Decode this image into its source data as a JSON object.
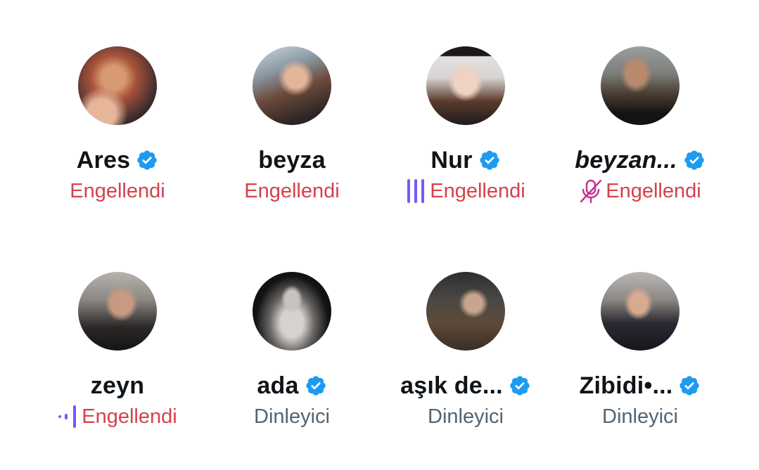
{
  "colors": {
    "blocked": "#d4424b",
    "listener": "#536471",
    "verified": "#1d9bf0",
    "speaking_indicator": "#7856ff",
    "muted_mic": "#c3328f"
  },
  "participants": [
    {
      "name": "Ares",
      "verified": true,
      "status": "Engellendi",
      "status_kind": "blocked",
      "indicator": "none"
    },
    {
      "name": "beyza",
      "verified": false,
      "status": "Engellendi",
      "status_kind": "blocked",
      "indicator": "none"
    },
    {
      "name": "Nur",
      "verified": true,
      "status": "Engellendi",
      "status_kind": "blocked",
      "indicator": "speaking-bars-icon"
    },
    {
      "name": "beyzan...",
      "verified": true,
      "status": "Engellendi",
      "status_kind": "blocked",
      "indicator": "muted-mic-icon"
    },
    {
      "name": "zeyn",
      "verified": false,
      "status": "Engellendi",
      "status_kind": "blocked",
      "indicator": "audio-level-icon"
    },
    {
      "name": "ada",
      "verified": true,
      "status": "Dinleyici",
      "status_kind": "listener",
      "indicator": "none"
    },
    {
      "name": "aşık de...",
      "verified": true,
      "status": "Dinleyici",
      "status_kind": "listener",
      "indicator": "none"
    },
    {
      "name": "Zibidi•...",
      "verified": true,
      "status": "Dinleyici",
      "status_kind": "listener",
      "indicator": "none"
    }
  ]
}
